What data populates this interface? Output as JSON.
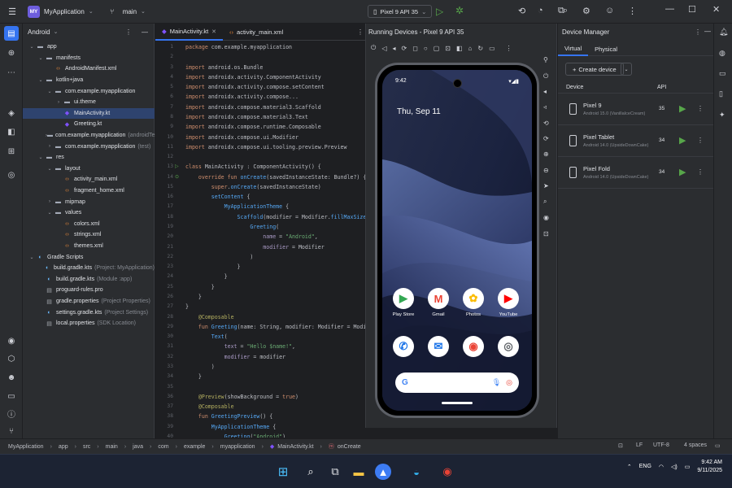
{
  "window": {
    "project_badge": "MY",
    "project_name": "MyApplication",
    "branch": "main",
    "device": "Pixel 9 API 35"
  },
  "project_panel": {
    "view": "Android",
    "tree": [
      {
        "label": "app",
        "depth": 0,
        "open": true,
        "icon": "folder-icon"
      },
      {
        "label": "manifests",
        "depth": 1,
        "open": true,
        "icon": "folder-icon"
      },
      {
        "label": "AndroidManifest.xml",
        "depth": 2,
        "icon": "xml-icon"
      },
      {
        "label": "kotlin+java",
        "depth": 1,
        "open": true,
        "icon": "folder-icon"
      },
      {
        "label": "com.example.myapplication",
        "depth": 2,
        "open": true,
        "icon": "folder-icon"
      },
      {
        "label": "ui.theme",
        "depth": 3,
        "open": false,
        "icon": "folder-icon"
      },
      {
        "label": "MainActivity.kt",
        "depth": 3,
        "icon": "kotlin-icon",
        "selected": true
      },
      {
        "label": "Greeting.kt",
        "depth": 3,
        "icon": "kotlin-icon"
      },
      {
        "label": "com.example.myapplication",
        "depth": 2,
        "open": false,
        "icon": "folder-icon",
        "hint": "(androidTest)"
      },
      {
        "label": "com.example.myapplication",
        "depth": 2,
        "open": false,
        "icon": "folder-icon",
        "hint": "(test)"
      },
      {
        "label": "res",
        "depth": 1,
        "open": true,
        "icon": "folder-icon"
      },
      {
        "label": "layout",
        "depth": 2,
        "open": true,
        "icon": "folder-icon"
      },
      {
        "label": "activity_main.xml",
        "depth": 3,
        "icon": "xml-icon"
      },
      {
        "label": "fragment_home.xml",
        "depth": 3,
        "icon": "xml-icon"
      },
      {
        "label": "mipmap",
        "depth": 2,
        "open": false,
        "icon": "folder-icon"
      },
      {
        "label": "values",
        "depth": 2,
        "open": true,
        "icon": "folder-icon"
      },
      {
        "label": "colors.xml",
        "depth": 3,
        "icon": "xml-icon"
      },
      {
        "label": "strings.xml",
        "depth": 3,
        "icon": "xml-icon"
      },
      {
        "label": "themes.xml",
        "depth": 3,
        "icon": "xml-icon"
      },
      {
        "label": "Gradle Scripts",
        "depth": 0,
        "open": true,
        "icon": "gradle-icon"
      },
      {
        "label": "build.gradle.kts",
        "depth": 1,
        "icon": "gradle-icon",
        "hint": "(Project: MyApplication)"
      },
      {
        "label": "build.gradle.kts",
        "depth": 1,
        "icon": "gradle-icon",
        "hint": "(Module :app)"
      },
      {
        "label": "proguard-rules.pro",
        "depth": 1,
        "icon": "file-icon"
      },
      {
        "label": "gradle.properties",
        "depth": 1,
        "icon": "file-icon",
        "hint": "(Project Properties)"
      },
      {
        "label": "settings.gradle.kts",
        "depth": 1,
        "icon": "gradle-icon",
        "hint": "(Project Settings)"
      },
      {
        "label": "local.properties",
        "depth": 1,
        "icon": "file-icon",
        "hint": "(SDK Location)"
      }
    ]
  },
  "editor": {
    "tabs": [
      {
        "label": "MainActivity.kt",
        "active": true,
        "icon": "kotlin-icon"
      },
      {
        "label": "activity_main.xml",
        "active": false,
        "icon": "xml-icon"
      }
    ],
    "lines": [
      [
        [
          "k",
          "package "
        ],
        [
          "t",
          "com.example.myapplication"
        ]
      ],
      [],
      [
        [
          "k",
          "import "
        ],
        [
          "t",
          "android.os.Bundle"
        ]
      ],
      [
        [
          "k",
          "import "
        ],
        [
          "t",
          "androidx.activity.ComponentActivity"
        ]
      ],
      [
        [
          "k",
          "import "
        ],
        [
          "t",
          "androidx.activity.compose.setContent"
        ]
      ],
      [
        [
          "k",
          "import "
        ],
        [
          "t",
          "androidx.activity.compose..."
        ]
      ],
      [
        [
          "k",
          "import "
        ],
        [
          "t",
          "androidx.compose.material3.Scaffold"
        ]
      ],
      [
        [
          "k",
          "import "
        ],
        [
          "t",
          "androidx.compose.material3.Text"
        ]
      ],
      [
        [
          "k",
          "import "
        ],
        [
          "t",
          "androidx.compose.runtime.Composable"
        ]
      ],
      [
        [
          "k",
          "import "
        ],
        [
          "t",
          "androidx.compose.ui.Modifier"
        ]
      ],
      [
        [
          "k",
          "import "
        ],
        [
          "t",
          "androidx.compose.ui.tooling.preview.Preview"
        ]
      ],
      [],
      [
        [
          "k",
          "class "
        ],
        [
          "t",
          "MainActivity : ComponentActivity() {"
        ]
      ],
      [
        [
          "t",
          "    "
        ],
        [
          "k",
          "override fun "
        ],
        [
          "f",
          "onCreate"
        ],
        [
          "t",
          "(savedInstanceState: Bundle?) {"
        ]
      ],
      [
        [
          "t",
          "        "
        ],
        [
          "k",
          "super"
        ],
        [
          "t",
          "."
        ],
        [
          "f",
          "onCreate"
        ],
        [
          "t",
          "(savedInstanceState)"
        ]
      ],
      [
        [
          "t",
          "        "
        ],
        [
          "f",
          "setContent"
        ],
        [
          "t",
          " {"
        ]
      ],
      [
        [
          "t",
          "            "
        ],
        [
          "f",
          "MyApplicationTheme"
        ],
        [
          "t",
          " {"
        ]
      ],
      [
        [
          "t",
          "                "
        ],
        [
          "f",
          "Scaffold"
        ],
        [
          "t",
          "(modifier = Modifier."
        ],
        [
          "f",
          "fillMaxSize"
        ],
        [
          "t",
          "()) {"
        ]
      ],
      [
        [
          "t",
          "                    "
        ],
        [
          "f",
          "Greeting"
        ],
        [
          "t",
          "("
        ]
      ],
      [
        [
          "t",
          "                        "
        ],
        [
          "p",
          "name"
        ],
        [
          "t",
          " = "
        ],
        [
          "s",
          "\"Android\""
        ],
        [
          "t",
          ","
        ]
      ],
      [
        [
          "t",
          "                        "
        ],
        [
          "p",
          "modifier"
        ],
        [
          "t",
          " = Modifier"
        ]
      ],
      [
        [
          "t",
          "                    )"
        ]
      ],
      [
        [
          "t",
          "                }"
        ]
      ],
      [
        [
          "t",
          "            }"
        ]
      ],
      [
        [
          "t",
          "        }"
        ]
      ],
      [
        [
          "t",
          "    }"
        ]
      ],
      [
        [
          "t",
          "}"
        ]
      ],
      [
        [
          "t",
          "    "
        ],
        [
          "a",
          "@Composable"
        ]
      ],
      [
        [
          "t",
          "    "
        ],
        [
          "k",
          "fun "
        ],
        [
          "f",
          "Greeting"
        ],
        [
          "t",
          "(name: String, modifier: Modifier = Modifier) {"
        ]
      ],
      [
        [
          "t",
          "        "
        ],
        [
          "f",
          "Text"
        ],
        [
          "t",
          "("
        ]
      ],
      [
        [
          "t",
          "            "
        ],
        [
          "p",
          "text"
        ],
        [
          "t",
          " = "
        ],
        [
          "s",
          "\"Hello $name!\""
        ],
        [
          "t",
          ","
        ]
      ],
      [
        [
          "t",
          "            "
        ],
        [
          "p",
          "modifier"
        ],
        [
          "t",
          " = modifier"
        ]
      ],
      [
        [
          "t",
          "        )"
        ]
      ],
      [
        [
          "t",
          "    }"
        ]
      ],
      [],
      [
        [
          "t",
          "    "
        ],
        [
          "a",
          "@Preview"
        ],
        [
          "t",
          "(showBackground = "
        ],
        [
          "k",
          "true"
        ],
        [
          "t",
          ")"
        ]
      ],
      [
        [
          "t",
          "    "
        ],
        [
          "a",
          "@Composable"
        ]
      ],
      [
        [
          "t",
          "    "
        ],
        [
          "k",
          "fun "
        ],
        [
          "f",
          "GreetingPreview"
        ],
        [
          "t",
          "() {"
        ]
      ],
      [
        [
          "t",
          "        "
        ],
        [
          "f",
          "MyApplicationTheme"
        ],
        [
          "t",
          " {"
        ]
      ],
      [
        [
          "t",
          "            "
        ],
        [
          "f",
          "Greeting"
        ],
        [
          "t",
          "("
        ],
        [
          "s",
          "\"Android\""
        ],
        [
          "t",
          ")"
        ]
      ],
      [
        [
          "t",
          "        }"
        ]
      ],
      [
        [
          "t",
          "    }"
        ]
      ]
    ]
  },
  "running_devices": {
    "title": "Running Devices - Pixel 9 API 35",
    "phone": {
      "time": "9:42",
      "date": "Thu, Sep 11",
      "apps_row1": [
        {
          "label": "Play Store",
          "icon": "play-store-icon",
          "glyph": "▶",
          "color": "#34a853"
        },
        {
          "label": "Gmail",
          "icon": "gmail-icon",
          "glyph": "M",
          "color": "#ea4335"
        },
        {
          "label": "Photos",
          "icon": "photos-icon",
          "glyph": "✿",
          "color": "#fbbc04"
        },
        {
          "label": "YouTube",
          "icon": "youtube-icon",
          "glyph": "▶",
          "color": "#ff0000"
        }
      ],
      "apps_row2": [
        {
          "label": "",
          "icon": "phone-app-icon",
          "glyph": "✆",
          "color": "#1a73e8"
        },
        {
          "label": "",
          "icon": "messages-app-icon",
          "glyph": "✉",
          "color": "#1a73e8"
        },
        {
          "label": "",
          "icon": "chrome-app-icon",
          "glyph": "◉",
          "color": "#ea4335"
        },
        {
          "label": "",
          "icon": "camera-app-icon",
          "glyph": "◎",
          "color": "#5f6368"
        }
      ],
      "search_g": "G"
    }
  },
  "device_manager": {
    "title": "Device Manager",
    "tabs": [
      "Virtual",
      "Physical"
    ],
    "create_label": "Create device",
    "col_device": "Device",
    "col_api": "API",
    "devices": [
      {
        "name": "Pixel 9",
        "sub": "Android 15.0 (VanillaIceCream)",
        "api": "35"
      },
      {
        "name": "Pixel Tablet",
        "sub": "Android 14.0 (UpsideDownCake)",
        "api": "34"
      },
      {
        "name": "Pixel Fold",
        "sub": "Android 14.0 (UpsideDownCake)",
        "api": "34"
      }
    ]
  },
  "statusbar": {
    "breadcrumbs": [
      "MyApplication",
      "app",
      "src",
      "main",
      "java",
      "com",
      "example",
      "myapplication",
      "MainActivity.kt",
      "onCreate"
    ],
    "line_ending": "LF",
    "encoding": "UTF-8",
    "indent": "4 spaces"
  },
  "taskbar": {
    "lang": "ENG",
    "time": "9:42 AM",
    "date": "9/11/2025"
  }
}
